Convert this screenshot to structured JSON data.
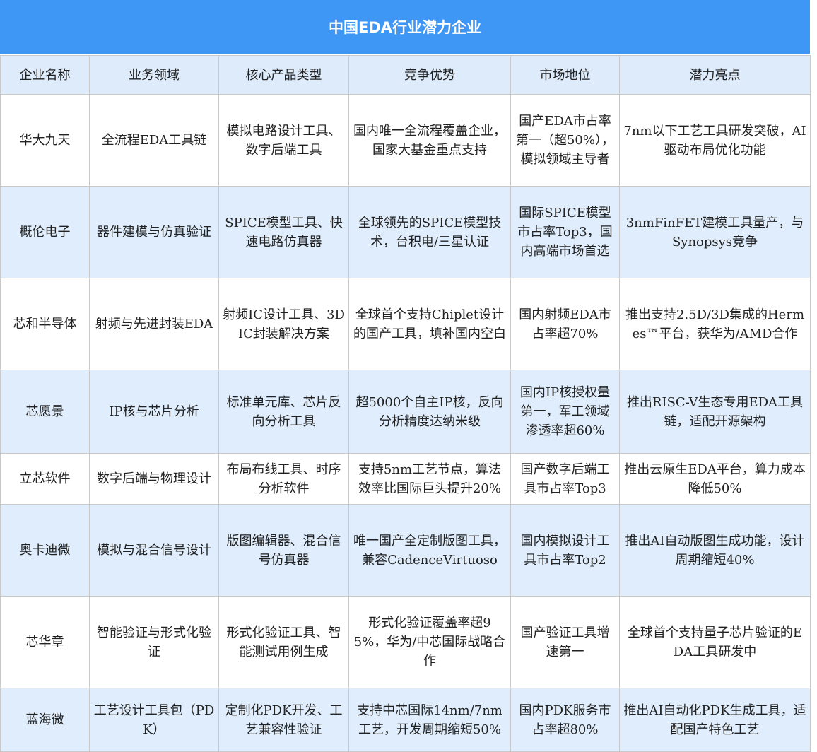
{
  "title": "中国EDA行业潜力企业",
  "headers": [
    "企业名称",
    "业务领域",
    "核心产品类型",
    "竞争优势",
    "市场地位",
    "潜力亮点"
  ],
  "rows": [
    [
      "华大九天",
      "全流程EDA工具链",
      "模拟电路设计工具、数字后端工具",
      "国内唯一全流程覆盖企业，国家大基金重点支持",
      "国产EDA市占率第一（超50%），模拟领域主导者",
      "7nm以下工艺工具研发突破，AI驱动布局优化功能"
    ],
    [
      "概伦电子",
      "器件建模与仿真验证",
      "SPICE模型工具、快速电路仿真器",
      "全球领先的SPICE模型技术，台积电/三星认证",
      "国际SPICE模型市占率Top3，国内高端市场首选",
      "3nmFinFET建模工具量产，与Synopsys竞争"
    ],
    [
      "芯和半导体",
      "射频与先进封装EDA",
      "射频IC设计工具、3DIC封装解决方案",
      "全球首个支持Chiplet设计的国产工具，填补国内空白",
      "国内射频EDA市占率超70%",
      "推出支持2.5D/3D集成的Hermes™平台，获华为/AMD合作"
    ],
    [
      "芯愿景",
      "IP核与芯片分析",
      "标准单元库、芯片反向分析工具",
      "超5000个自主IP核，反向分析精度达纳米级",
      "国内IP核授权量第一，军工领域渗透率超60%",
      "推出RISC-V生态专用EDA工具链，适配开源架构"
    ],
    [
      "立芯软件",
      "数字后端与物理设计",
      "布局布线工具、时序分析软件",
      "支持5nm工艺节点，算法效率比国际巨头提升20%",
      "国产数字后端工具市占率Top3",
      "推出云原生EDA平台，算力成本降低50%"
    ],
    [
      "奥卡迪微",
      "模拟与混合信号设计",
      "版图编辑器、混合信号仿真器",
      "唯一国产全定制版图工具，兼容CadenceVirtuoso",
      "国内模拟设计工具市占率Top2",
      "推出AI自动版图生成功能，设计周期缩短40%"
    ],
    [
      "芯华章",
      "智能验证与形式化验证",
      "形式化验证工具、智能测试用例生成",
      "形式化验证覆盖率超95%，华为/中芯国际战略合作",
      "国产验证工具增速第一",
      "全球首个支持量子芯片验证的EDA工具研发中"
    ],
    [
      "蓝海微",
      "工艺设计工具包（PDK）",
      "定制化PDK开发、工艺兼容性验证",
      "支持中芯国际14nm/7nm工艺，开发周期缩短50%",
      "国内PDK服务市占率超80%",
      "推出AI自动化PDK生成工具，适配国产特色工艺"
    ]
  ]
}
